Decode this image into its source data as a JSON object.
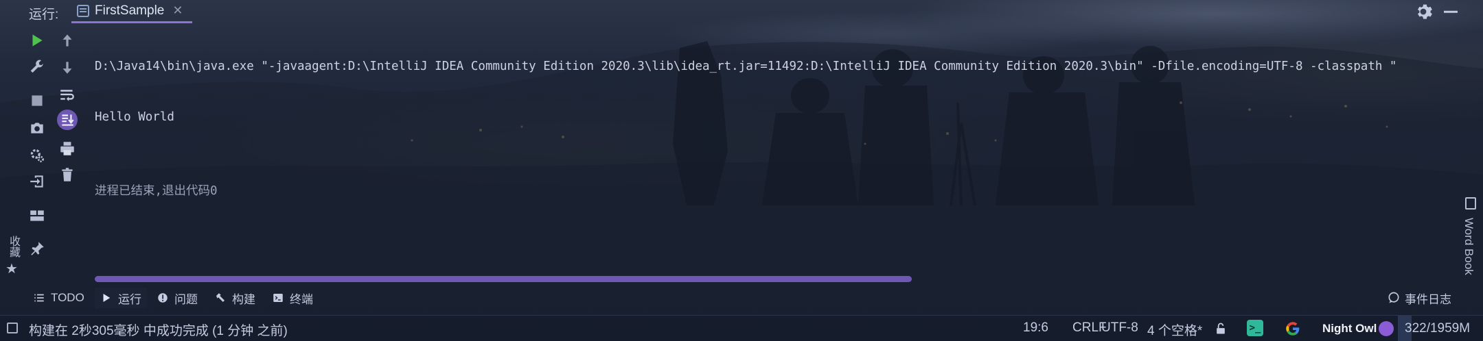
{
  "header": {
    "run_label": "运行:",
    "tab_title": "FirstSample"
  },
  "console": {
    "lines": [
      "D:\\Java14\\bin\\java.exe \"-javaagent:D:\\IntelliJ IDEA Community Edition 2020.3\\lib\\idea_rt.jar=11492:D:\\IntelliJ IDEA Community Edition 2020.3\\bin\" -Dfile.encoding=UTF-8 -classpath \"",
      "Hello World"
    ],
    "exit_message": "进程已结束,退出代码0"
  },
  "left_toolbar": {
    "icons": [
      "run-icon",
      "wrench-icon",
      "stop-icon",
      "camera-icon",
      "settings-gear-icon",
      "exit-icon",
      "layout-icon",
      "pin-icon"
    ],
    "second_column_icons": [
      "up-arrow-icon",
      "down-arrow-icon",
      "soft-wrap-icon",
      "scroll-to-end-icon",
      "print-icon",
      "trash-icon"
    ]
  },
  "side": {
    "favorites_label": "收藏",
    "word_book_label": "Word Book"
  },
  "bottom_tabs": [
    {
      "label": "TODO",
      "icon": "list-icon"
    },
    {
      "label": "运行",
      "icon": "play-icon"
    },
    {
      "label": "问题",
      "icon": "info-icon"
    },
    {
      "label": "构建",
      "icon": "hammer-icon"
    },
    {
      "label": "终端",
      "icon": "terminal-icon"
    }
  ],
  "event_log_label": "事件日志",
  "status_bar": {
    "message": "构建在 2秒305毫秒 中成功完成 (1 分钟 之前)",
    "position": "19:6",
    "line_separator": "CRLF",
    "encoding": "UTF-8",
    "indent": "4 个空格*",
    "terminal_plugin": ">_",
    "theme": "Night Owl",
    "memory": "322/1959M",
    "memory_used_fraction": 0.16
  },
  "colors": {
    "accent": "#8b74d6",
    "scrollbar": "#6e58b4",
    "run_green": "#4fc14f"
  }
}
